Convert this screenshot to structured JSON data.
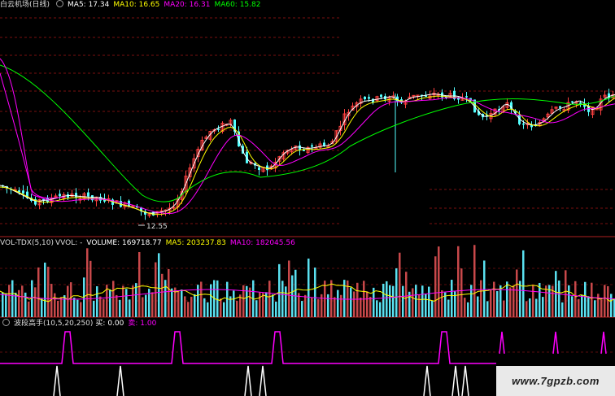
{
  "main_header": {
    "title": "白云机场(日线)",
    "ma5": "MA5: 17.34",
    "ma10": "MA10: 16.65",
    "ma20": "MA20: 16.31",
    "ma60": "MA60: 15.82"
  },
  "low_marker": "12.55",
  "vol_header": {
    "title": "VOL-TDX(5,10)",
    "vvol": "VVOL: -",
    "volume": "VOLUME: 169718.77",
    "ma5": "MA5: 203237.83",
    "ma10": "MA10: 182045.56"
  },
  "ind_header": {
    "title": "波段高手(10,5,20,250)",
    "buy": "买: 0.00",
    "sell": "卖: 1.00"
  },
  "watermark": "www.7gpzb.com",
  "colors": {
    "up": "#ff4040",
    "down": "#54ffff",
    "ma5": "#ffffff",
    "ma10": "#ffff00",
    "ma20": "#ff00ff",
    "ma60": "#00ff00",
    "sell": "#ff00ff",
    "buy": "#ffffff"
  }
}
